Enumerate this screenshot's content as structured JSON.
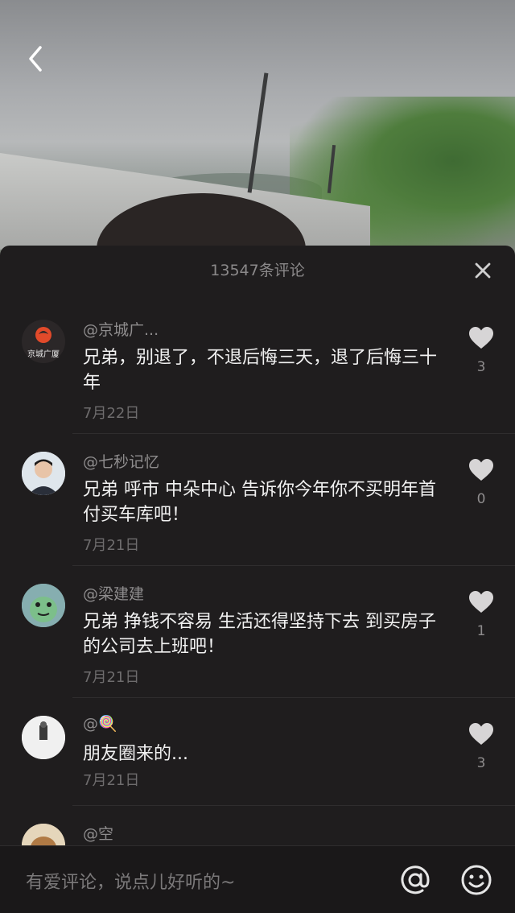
{
  "header": {
    "title": "13547条评论"
  },
  "comments": [
    {
      "user": "@京城广...",
      "avatar_text": "京城广厦",
      "text": "兄弟，别退了，不退后悔三天，退了后悔三十年",
      "date": "7月22日",
      "likes": "3"
    },
    {
      "user": "@七秒记忆",
      "text": "兄弟 呼市 中朵中心 告诉你今年你不买明年首付买车库吧！",
      "date": "7月21日",
      "likes": "0"
    },
    {
      "user": "@梁建建",
      "text": "兄弟 挣钱不容易 生活还得坚持下去  到买房子的公司去上班吧！",
      "date": "7月21日",
      "likes": "1"
    },
    {
      "user": "@🍭",
      "text": "朋友圈来的...",
      "date": "7月21日",
      "likes": "3"
    },
    {
      "user": "@空",
      "text": "",
      "date": "",
      "likes": ""
    }
  ],
  "input": {
    "placeholder": "有爱评论，说点儿好听的~"
  },
  "colors": {
    "sheet_bg": "#1f1d1e",
    "text": "#f1f1f1",
    "muted": "#8e8c8d"
  },
  "icons": [
    "back-icon",
    "close-icon",
    "heart-icon",
    "at-icon",
    "emoji-icon"
  ]
}
